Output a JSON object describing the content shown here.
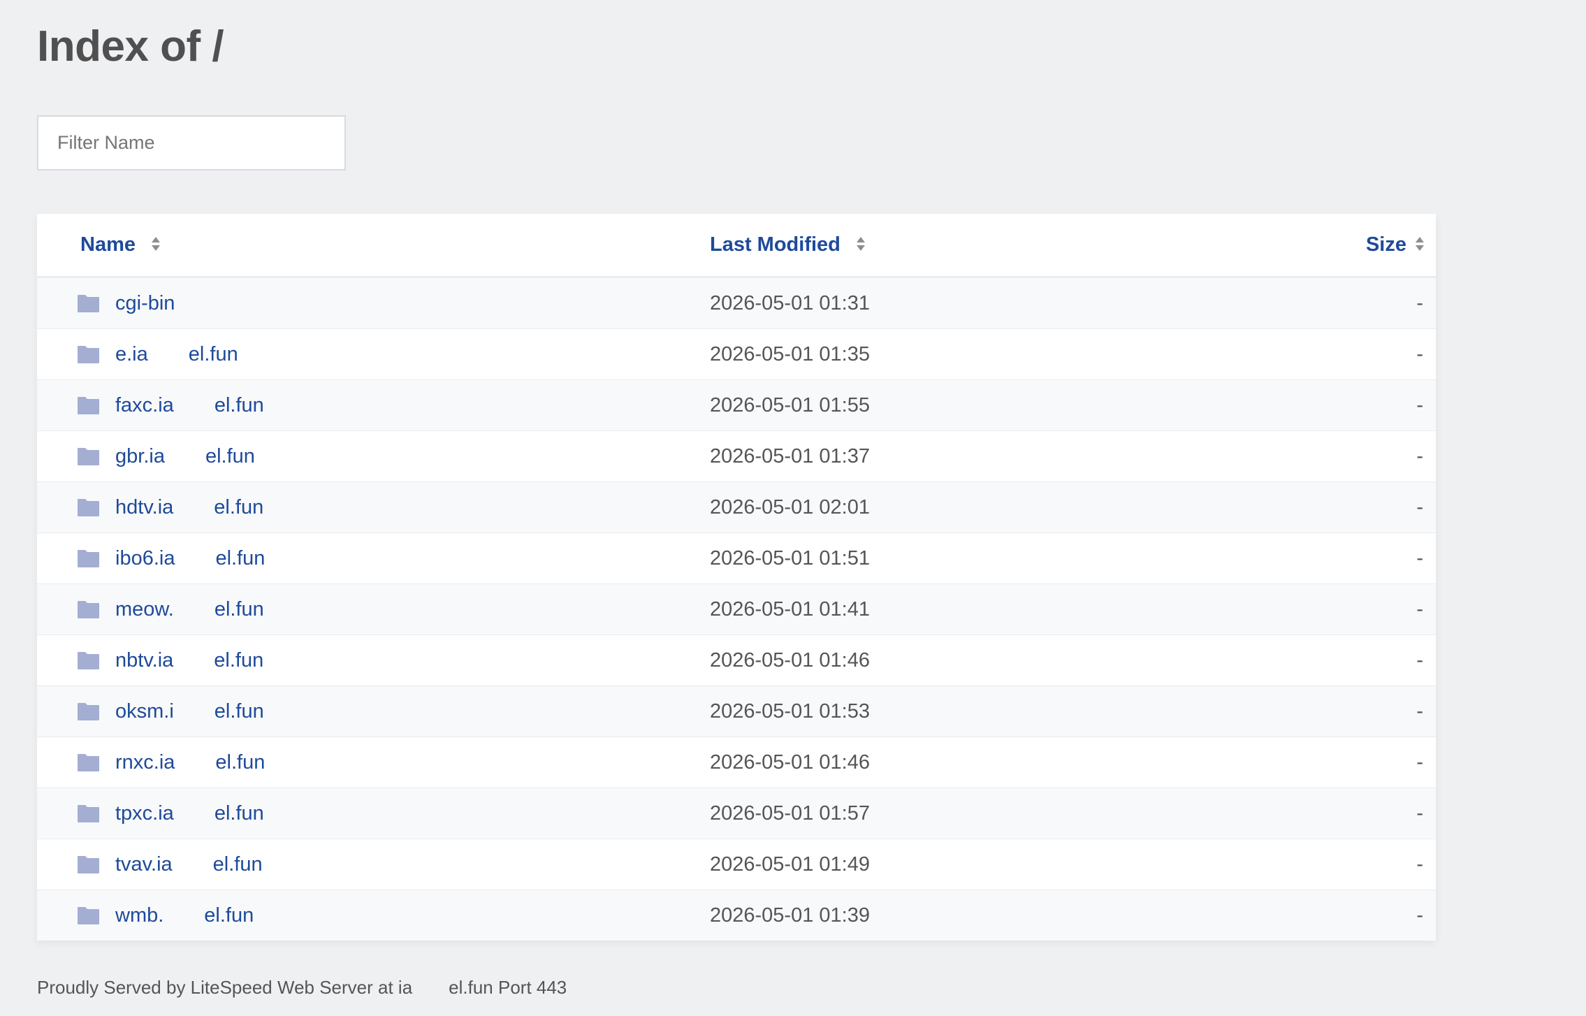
{
  "page": {
    "title": "Index of /",
    "filter_placeholder": "Filter Name"
  },
  "table": {
    "headers": {
      "name": "Name",
      "modified": "Last Modified",
      "size": "Size"
    },
    "rows": [
      {
        "name": "cgi-bin",
        "modified": "2026-05-01 01:31",
        "size": "-"
      },
      {
        "name": "e.ia  el.fun",
        "modified": "2026-05-01 01:35",
        "size": "-"
      },
      {
        "name": "faxc.ia  el.fun",
        "modified": "2026-05-01 01:55",
        "size": "-"
      },
      {
        "name": "gbr.ia  el.fun",
        "modified": "2026-05-01 01:37",
        "size": "-"
      },
      {
        "name": "hdtv.ia  el.fun",
        "modified": "2026-05-01 02:01",
        "size": "-"
      },
      {
        "name": "ibo6.ia  el.fun",
        "modified": "2026-05-01 01:51",
        "size": "-"
      },
      {
        "name": "meow.  el.fun",
        "modified": "2026-05-01 01:41",
        "size": "-"
      },
      {
        "name": "nbtv.ia  el.fun",
        "modified": "2026-05-01 01:46",
        "size": "-"
      },
      {
        "name": "oksm.i  el.fun",
        "modified": "2026-05-01 01:53",
        "size": "-"
      },
      {
        "name": "rnxc.ia  el.fun",
        "modified": "2026-05-01 01:46",
        "size": "-"
      },
      {
        "name": "tpxc.ia  el.fun",
        "modified": "2026-05-01 01:57",
        "size": "-"
      },
      {
        "name": "tvav.ia  el.fun",
        "modified": "2026-05-01 01:49",
        "size": "-"
      },
      {
        "name": "wmb.  el.fun",
        "modified": "2026-05-01 01:39",
        "size": "-"
      }
    ]
  },
  "footer": {
    "text": "Proudly Served by LiteSpeed Web Server at ia  el.fun Port 443"
  },
  "colors": {
    "background": "#eff0f2",
    "link": "#1e4a9a",
    "folder_icon": "#a3aed2",
    "text": "#555555"
  },
  "icons": {
    "folder": "folder-icon",
    "sort": "sort-arrows-icon"
  }
}
